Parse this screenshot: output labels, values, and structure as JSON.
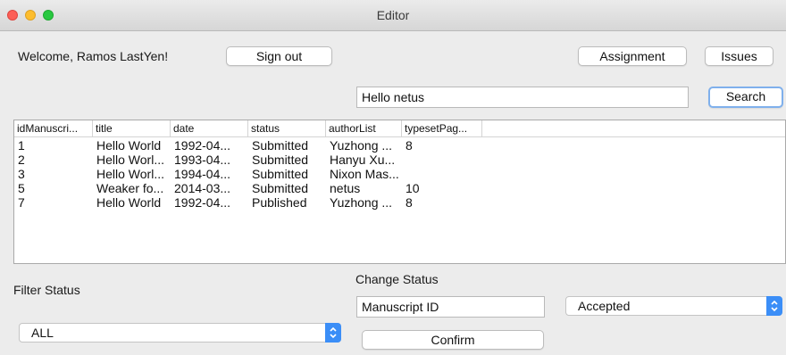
{
  "window": {
    "title": "Editor"
  },
  "header": {
    "welcome": "Welcome, Ramos LastYen!",
    "sign_out": "Sign out",
    "assignment": "Assignment",
    "issues": "Issues"
  },
  "search": {
    "value": "Hello netus",
    "button": "Search"
  },
  "table": {
    "columns": [
      "idManuscri...",
      "title",
      "date",
      "status",
      "authorList",
      "typesetPag..."
    ],
    "rows": [
      [
        "1",
        "Hello World",
        "1992-04...",
        "Submitted",
        "Yuzhong ...",
        "8"
      ],
      [
        "2",
        "Hello Worl...",
        "1993-04...",
        "Submitted",
        "Hanyu Xu...",
        ""
      ],
      [
        "3",
        "Hello Worl...",
        "1994-04...",
        "Submitted",
        "Nixon Mas...",
        ""
      ],
      [
        "5",
        "Weaker fo...",
        "2014-03...",
        "Submitted",
        "netus",
        "10"
      ],
      [
        "7",
        "Hello World",
        "1992-04...",
        "Published",
        "Yuzhong ...",
        "8"
      ]
    ]
  },
  "filter": {
    "label": "Filter Status",
    "selected": "ALL"
  },
  "change_status": {
    "label": "Change Status",
    "manuscript_id": "Manuscript ID",
    "status_selected": "Accepted",
    "confirm": "Confirm"
  },
  "colors": {
    "accent": "#3b8ef7",
    "focus_ring": "#7fb0ec"
  },
  "icons": [
    "close-icon",
    "minimize-icon",
    "zoom-icon",
    "select-stepper-icon"
  ]
}
